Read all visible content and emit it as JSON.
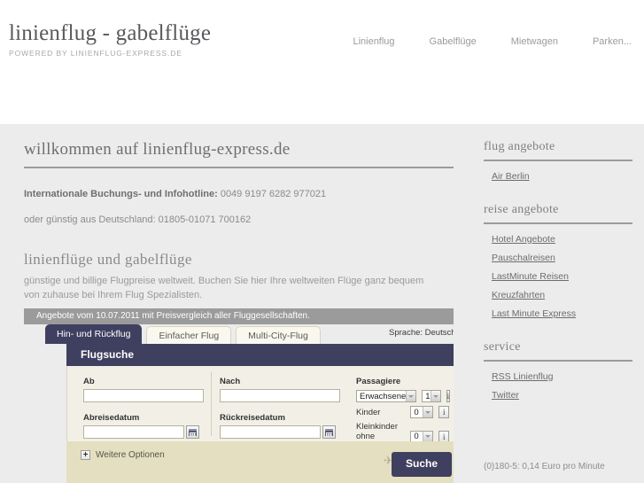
{
  "header": {
    "brand_title": "linienflug - gabelflüge",
    "brand_tagline": "POWERED BY LINIENFLUG-EXPRESS.DE",
    "nav": [
      {
        "label": "Linienflug"
      },
      {
        "label": "Gabelflüge"
      },
      {
        "label": "Mietwagen"
      },
      {
        "label": "Parken..."
      }
    ]
  },
  "main": {
    "page_heading": "willkommen auf linienflug-express.de",
    "hotline_label": "Internationale Buchungs- und Infohotline:",
    "hotline_number": " 0049 9197 6282 977021",
    "hotline_germany": "oder günstig aus Deutschland: 01805-01071 700162",
    "section_heading": "linienflüge und gabelflüge",
    "lede": "günstige und billige Flugpreise weltweit. Buchen Sie hier Ihre weltweiten Flüge ganz bequem von zuhause bei Ihrem Flug Spezialisten."
  },
  "widget": {
    "offer_bar": "Angebote vom 10.07.2011 mit Preisvergleich aller Fluggesellschaften.",
    "tabs": [
      {
        "label": "Hin- und Rückflug",
        "active": true
      },
      {
        "label": "Einfacher Flug",
        "active": false
      },
      {
        "label": "Multi-City-Flug",
        "active": false
      }
    ],
    "language": "Sprache: Deutsch",
    "title": "Flugsuche",
    "fields": {
      "from_label": "Ab",
      "from_value": "",
      "to_label": "Nach",
      "to_value": "",
      "depart_label": "Abreisedatum",
      "depart_value": "",
      "return_label": "Rückreisedatum",
      "return_value": ""
    },
    "passengers": {
      "title": "Passagiere",
      "adults_type": "Erwachsene",
      "adults_count": "1",
      "children_label": "Kinder",
      "children_count": "0",
      "infants_label": "Kleinkinder ohne Sitzplatz",
      "infants_count": "0",
      "info_glyph": "i"
    },
    "more_options_plus": "+",
    "more_options_label": "Weitere Optionen",
    "search_button": "Suche"
  },
  "sidebar": {
    "blocks": [
      {
        "heading": "flug angebote",
        "links": [
          {
            "label": "Air Berlin"
          }
        ]
      },
      {
        "heading": "reise angebote",
        "links": [
          {
            "label": "Hotel Angebote"
          },
          {
            "label": "Pauschalreisen"
          },
          {
            "label": "LastMinute Reisen"
          },
          {
            "label": "Kreuzfahrten"
          },
          {
            "label": "Last Minute Express"
          }
        ]
      },
      {
        "heading": "service",
        "links": [
          {
            "label": "RSS Linienflug"
          },
          {
            "label": "Twitter"
          }
        ]
      }
    ],
    "footnote": "(0)180-5: 0,14 Euro pro Minute"
  },
  "colors": {
    "accent_navy": "#3f3f60",
    "band_gray": "#ececec",
    "offer_gray": "#9b9b9b",
    "form_cream": "#f2f0e6",
    "bottom_khaki": "#e4dfc0"
  }
}
